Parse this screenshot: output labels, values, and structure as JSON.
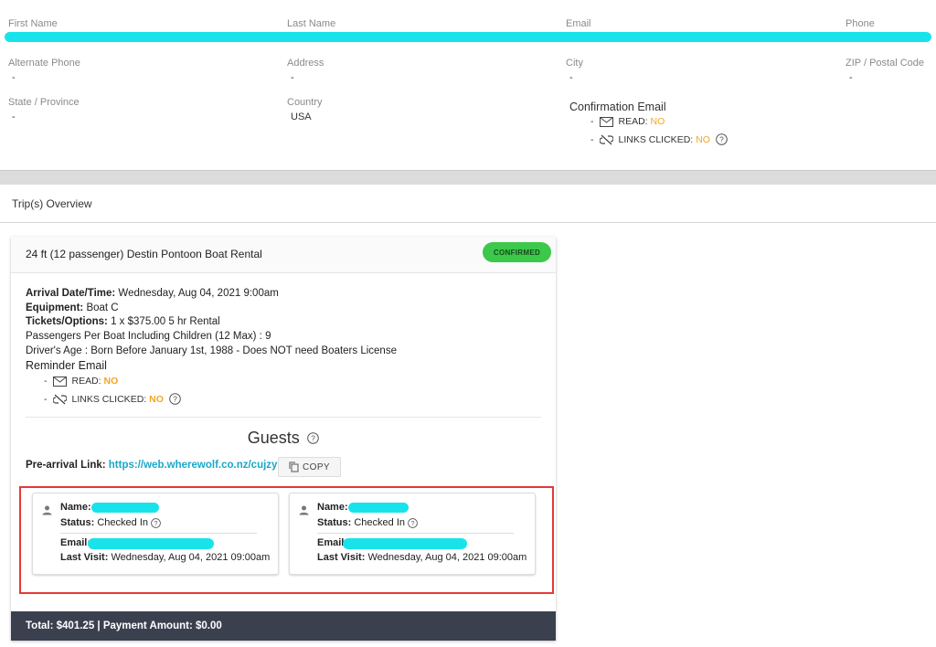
{
  "contact": {
    "first_name_label": "First Name",
    "last_name_label": "Last Name",
    "email_label": "Email",
    "phone_label": "Phone",
    "alt_phone_label": "Alternate Phone",
    "alt_phone_value": "-",
    "address_label": "Address",
    "address_value": "-",
    "city_label": "City",
    "city_value": "-",
    "zip_label": "ZIP / Postal Code",
    "zip_value": "-",
    "state_label": "State / Province",
    "state_value": "-",
    "country_label": "Country",
    "country_value": "USA"
  },
  "confirmation_email": {
    "title": "Confirmation Email",
    "dash": "-",
    "read_label": "READ:",
    "read_value": "NO",
    "links_label": "LINKS CLICKED:",
    "links_value": "NO"
  },
  "trips_overview": {
    "title": "Trip(s) Overview"
  },
  "trip": {
    "title": "24 ft (12 passenger) Destin Pontoon Boat Rental",
    "status": "CONFIRMED",
    "arrival_label": "Arrival Date/Time:",
    "arrival_value": "Wednesday, Aug 04, 2021 9:00am",
    "equipment_label": "Equipment:",
    "equipment_value": "Boat C",
    "tickets_label": "Tickets/Options:",
    "tickets_value": "1 x $375.00 5 hr Rental",
    "passengers_line": "Passengers Per Boat Including Children (12 Max) : 9",
    "drivers_age_line": "Driver's Age : Born Before January 1st, 1988 - Does NOT need Boaters License",
    "reminder_title": "Reminder Email",
    "dash": "-",
    "read_label": "READ:",
    "read_value": "NO",
    "links_label": "LINKS CLICKED:",
    "links_value": "NO",
    "guests_title": "Guests",
    "prearrival_label": "Pre-arrival Link:",
    "prearrival_link": "https://web.wherewolf.co.nz/cujzyu",
    "copy_label": "COPY",
    "guests": [
      {
        "name_label": "Name:",
        "status_label": "Status:",
        "status_value": "Checked In",
        "email_label": "Email:",
        "last_visit_label": "Last Visit:",
        "last_visit_value": "Wednesday, Aug 04, 2021 09:00am"
      },
      {
        "name_label": "Name:",
        "status_label": "Status:",
        "status_value": "Checked In",
        "email_label": "Email:",
        "last_visit_label": "Last Visit:",
        "last_visit_value": "Wednesday, Aug 04, 2021 09:00am"
      }
    ],
    "footer": "Total: $401.25 | Payment Amount: $0.00"
  },
  "colors": {
    "accent_link": "#1aa7c9",
    "status_green": "#3cc84a",
    "warning_orange": "#f5a623",
    "footer_bg": "#3b404f",
    "redaction": "#19e3ea",
    "highlight_border": "#e53935"
  },
  "icons": [
    "envelope-icon",
    "link-off-icon",
    "help-circle-icon",
    "person-icon",
    "copy-icon"
  ]
}
